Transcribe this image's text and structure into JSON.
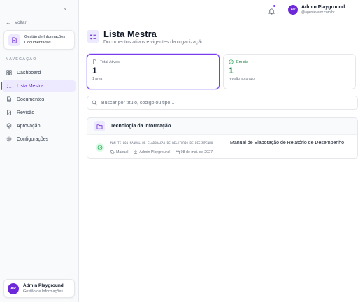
{
  "sidebar": {
    "back_label": "Voltar",
    "module": "Gestão de Informações Documentadas",
    "nav_heading": "NAVEGAÇÃO",
    "items": [
      {
        "label": "Dashboard",
        "icon": "grid-icon"
      },
      {
        "label": "Lista Mestra",
        "icon": "list-check-icon",
        "active": true
      },
      {
        "label": "Documentos",
        "icon": "file-text-icon"
      },
      {
        "label": "Revisão",
        "icon": "file-edit-icon"
      },
      {
        "label": "Aprovação",
        "icon": "shield-check-icon"
      },
      {
        "label": "Configurações",
        "icon": "gear-icon"
      }
    ],
    "user": {
      "initials": "AP",
      "name": "Admin Playground",
      "subtitle": "Gestão de Informações..."
    }
  },
  "header": {
    "user": {
      "initials": "AP",
      "name": "Admin Playground",
      "email": "@agentevalor.com.br"
    }
  },
  "page": {
    "title": "Lista Mestra",
    "subtitle": "Documentos ativos e vigentes da organização"
  },
  "stats": [
    {
      "label": "Total Ativos",
      "value": "1",
      "note": "1 área"
    },
    {
      "label": "Em dia",
      "value": "1",
      "note": "revisão no prazo"
    }
  ],
  "search": {
    "placeholder": "Buscar por título, código ou tipo..."
  },
  "group": {
    "title": "Tecnologia da Informação",
    "documents": [
      {
        "code": "MAN-TI-001-MANUAL-DE-ELABORACAO-DE-RELATORIO-DE-DESEMPENHO",
        "title": "Manual de Elaboração de Relatório de Desempenho",
        "type": "Manual",
        "owner": "Admin Playground",
        "date": "08 de mai. de 2027"
      }
    ]
  },
  "colors": {
    "accent": "#7c3aed",
    "accent_light": "#ede9fe",
    "success": "#16a34a"
  }
}
